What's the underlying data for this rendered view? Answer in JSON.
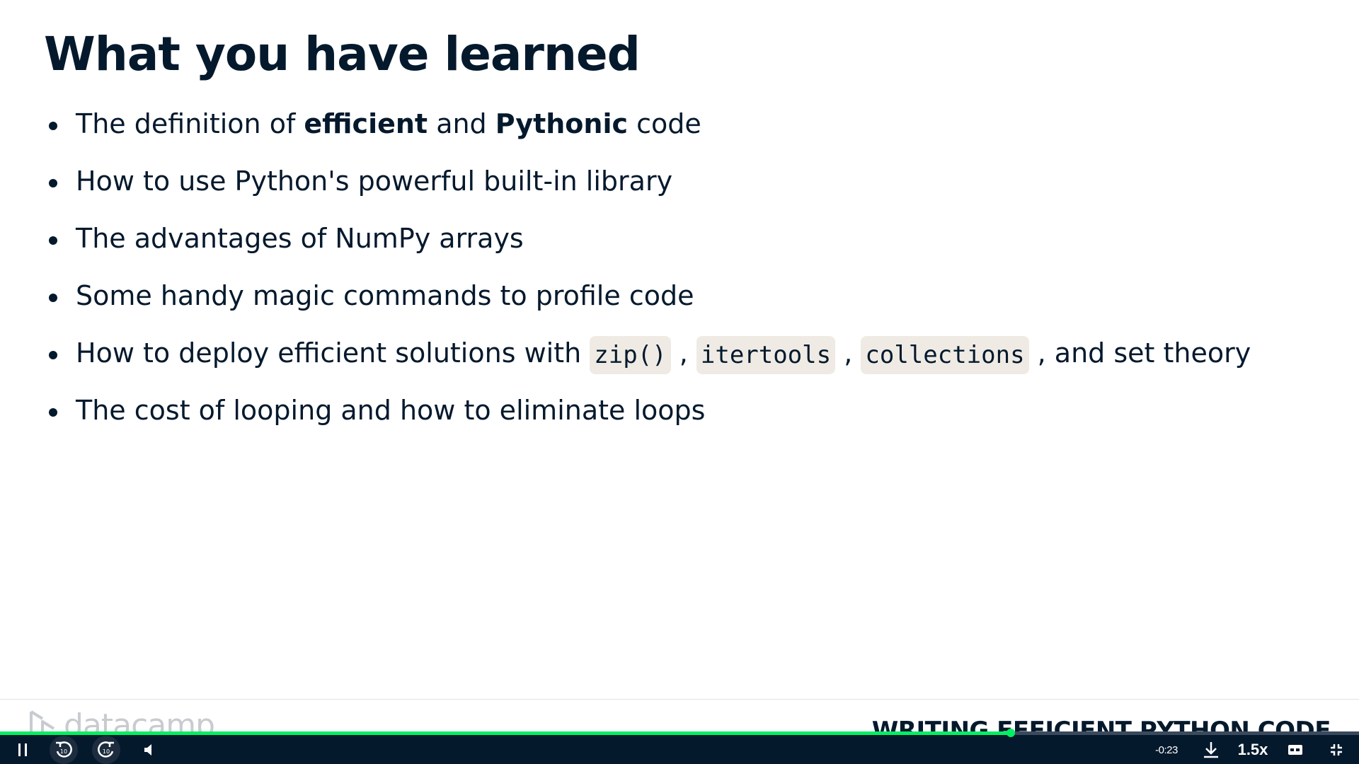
{
  "slide": {
    "title": "What you have learned",
    "bullets": [
      {
        "parts": [
          {
            "text": "The definition of ",
            "style": "normal"
          },
          {
            "text": "efficient",
            "style": "bold"
          },
          {
            "text": " and ",
            "style": "normal"
          },
          {
            "text": "Pythonic",
            "style": "bold"
          },
          {
            "text": " code",
            "style": "normal"
          }
        ]
      },
      {
        "parts": [
          {
            "text": "How to use Python's powerful built-in library",
            "style": "normal"
          }
        ]
      },
      {
        "parts": [
          {
            "text": "The advantages of NumPy arrays",
            "style": "normal"
          }
        ]
      },
      {
        "parts": [
          {
            "text": "Some handy magic commands to profile code",
            "style": "normal"
          }
        ]
      },
      {
        "parts": [
          {
            "text": "How to deploy efficient solutions with ",
            "style": "normal"
          },
          {
            "text": "zip()",
            "style": "code"
          },
          {
            "text": " , ",
            "style": "normal"
          },
          {
            "text": "itertools",
            "style": "code"
          },
          {
            "text": " , ",
            "style": "normal"
          },
          {
            "text": "collections",
            "style": "code"
          },
          {
            "text": " , and set theory",
            "style": "normal"
          }
        ]
      },
      {
        "parts": [
          {
            "text": "The cost of looping and how to eliminate loops",
            "style": "normal"
          }
        ]
      }
    ]
  },
  "footer": {
    "logo_text": "datacamp",
    "course_title": "WRITING EFFICIENT PYTHON CODE"
  },
  "player": {
    "time_remaining": "-0:23",
    "playback_speed": "1.5x",
    "progress_fraction": 0.744,
    "rewind_seconds": "10",
    "forward_seconds": "10",
    "icons": {
      "pause": "pause-icon",
      "rewind": "rewind-10-icon",
      "forward": "forward-10-icon",
      "volume": "volume-icon",
      "download": "download-icon",
      "captions": "captions-icon",
      "fullscreen": "exit-fullscreen-icon"
    },
    "colors": {
      "bar": "#05192d",
      "accent": "#03ef62"
    }
  }
}
